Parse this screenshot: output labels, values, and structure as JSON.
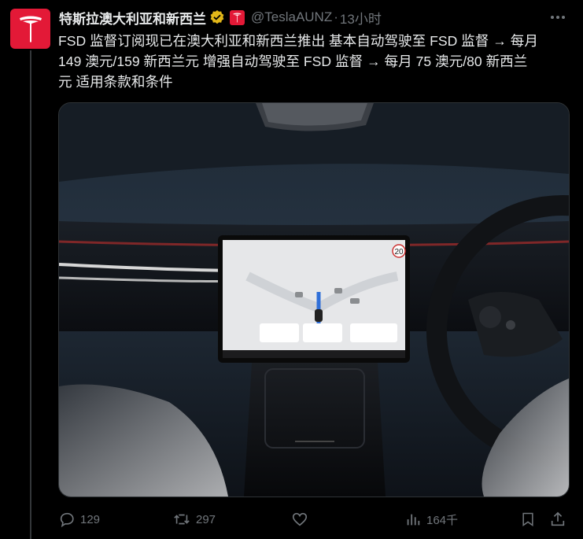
{
  "author": {
    "display_name": "特斯拉澳大利亚和新西兰",
    "handle": "@TeslaAUNZ",
    "separator": "·",
    "time": "13小时",
    "avatar_icon": "tesla-logo-icon",
    "brand_color": "#e31937"
  },
  "tweet": {
    "line1": "FSD 监督订阅现已在澳大利亚和新西兰推出 基本自动驾驶至 FSD 监督 → 每月",
    "line2": "149 澳元/159 新西兰元 增强自动驾驶至 FSD 监督 → 每月 75 澳元/80 新西兰",
    "line3": "元 适用条款和条件"
  },
  "media": {
    "screen_speed": "20"
  },
  "actions": {
    "replies": "129",
    "reposts": "297",
    "views": "164千"
  }
}
